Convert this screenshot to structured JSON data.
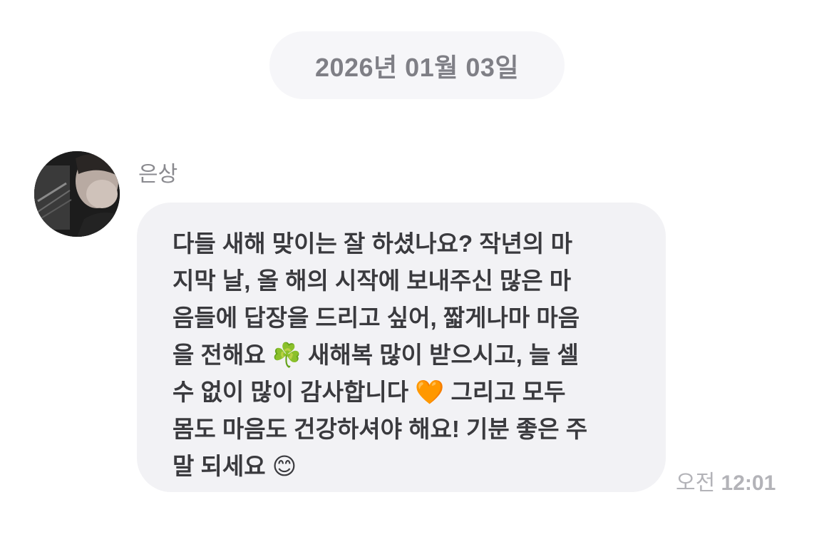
{
  "date_separator": "2026년 01월 03일",
  "message": {
    "sender": "은상",
    "avatar_icon": "profile-photo",
    "text": "다들 새해 맞이는 잘 하셨나요? 작년의 마\n지막 날, 올 해의 시작에 보내주신 많은 마\n음들에 답장을 드리고 싶어, 짧게나마 마음\n을 전해요 ☘️ 새해복 많이 받으시고, 늘 셀\n수 없이 많이 감사합니다 🧡 그리고 모두\n몸도 마음도 건강하셔야 해요! 기분 좋은 주\n말 되세요 😊",
    "time_period": "오전",
    "time": "12:01"
  },
  "colors": {
    "bubble_bg": "#f2f2f5",
    "date_pill_bg": "#f6f6f9",
    "text": "#3a3a3e",
    "muted": "#8a8a8f",
    "timestamp": "#b3b3b8"
  }
}
